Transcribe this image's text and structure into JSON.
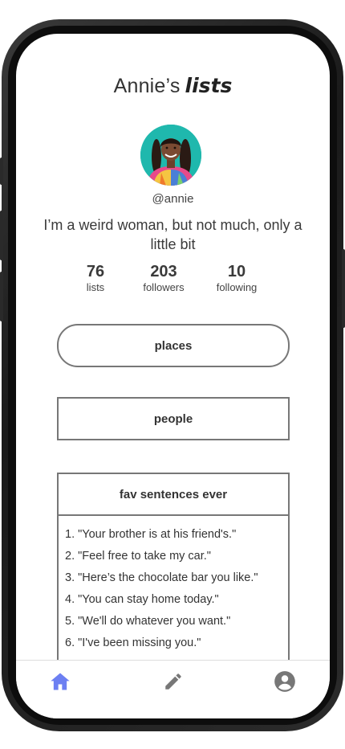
{
  "header": {
    "owner": "Annie’s",
    "title_word": "lists"
  },
  "profile": {
    "handle": "@annie",
    "bio": "I’m a weird  woman, but not much, only a little bit"
  },
  "stats": [
    {
      "value": "76",
      "label": "lists"
    },
    {
      "value": "203",
      "label": "followers"
    },
    {
      "value": "10",
      "label": "following"
    }
  ],
  "lists": {
    "places": "places",
    "people": "people",
    "fav": {
      "title": "fav sentences ever",
      "items": [
        "1. \"Your brother is at his friend's.\"",
        "2.  \"Feel free to take my car.\"",
        "3.  \"Here’s the chocolate bar you like.\"",
        "4. \"You can stay home today.\"",
        "5.  \"We'll do whatever you want.\"",
        "6.  \"I've been missing you.\""
      ]
    }
  },
  "tabbar": {
    "icons": [
      "home-icon",
      "pencil-icon",
      "account-icon"
    ],
    "active_color": "#6c7ff2",
    "inactive_color": "#777777"
  },
  "colors": {
    "avatar_bg": "#1fb8ad"
  }
}
